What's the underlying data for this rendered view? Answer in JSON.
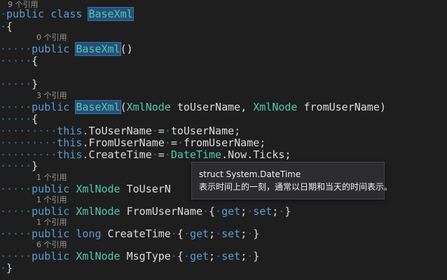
{
  "code_lens": {
    "class_refs": "9 个引用",
    "ctor1_refs": "0 个引用",
    "ctor2_refs": "3 个引用",
    "prop_to_refs": "1 个引用",
    "prop_from_refs": "1 个引用",
    "prop_time_refs": "1 个引用",
    "prop_msg_refs": "6 个引用"
  },
  "code": {
    "kw_public": "public",
    "kw_class": "class",
    "kw_this": "this",
    "kw_get": "get",
    "kw_set": "set",
    "kw_long": "long",
    "class_name": "BaseXml",
    "type_xmlnode": "XmlNode",
    "type_datetime": "DateTime",
    "param_to": "toUserName",
    "param_from": "fromUserName",
    "prop_to": "ToUserName",
    "prop_to_truncated": "ToUserN",
    "prop_from": "FromUserName",
    "prop_time": "CreateTime",
    "prop_msg": "MsgType",
    "now_ticks": "Now.Ticks",
    "open_brace": "{",
    "close_brace": "}"
  },
  "tooltip": {
    "signature": "struct System.DateTime",
    "description": "表示时间上的一刻，通常以日期和当天的时间表示。"
  },
  "colors": {
    "background": "#1e1e1e",
    "keyword": "#569cd6",
    "type": "#4ec9b0",
    "text": "#dcdcdc",
    "whitespace_dots": "#3c6d8c",
    "highlight": "#264f78"
  }
}
